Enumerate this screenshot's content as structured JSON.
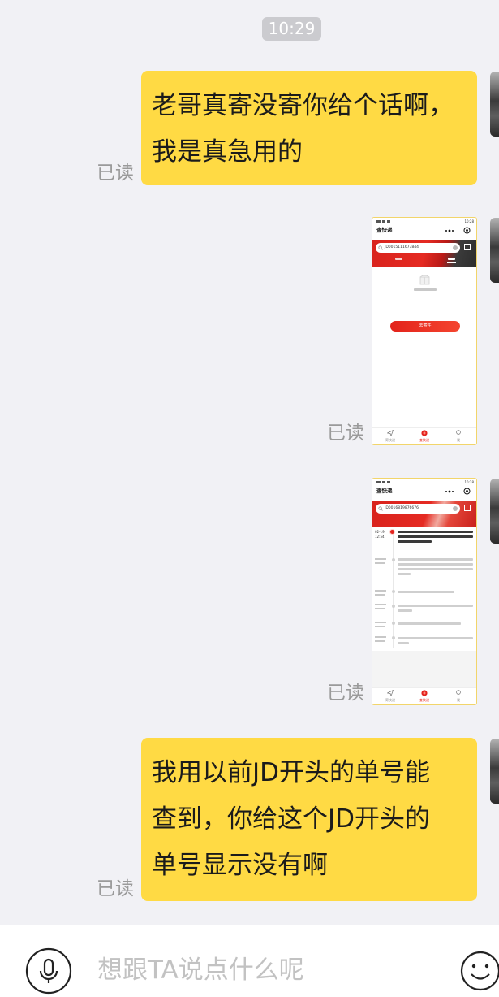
{
  "chat": {
    "time_divider": "10:29",
    "messages": [
      {
        "lines": [
          "老哥真寄没寄你给个话啊，",
          "我是真急用的"
        ],
        "read_status": "已读"
      },
      {
        "read_status": "已读",
        "screenshot": {
          "status_time": "10:28",
          "title": "查快递",
          "tracking_number": "JD0015111677844",
          "button_label": "去寄件",
          "nav": [
            "寄快递",
            "查快递",
            "我"
          ]
        }
      },
      {
        "read_status": "已读",
        "screenshot": {
          "status_time": "10:28",
          "title": "查快递",
          "tracking_number": "JD0016819876676",
          "first_event": {
            "date": "02-19",
            "time": "12:54"
          },
          "nav": [
            "寄快递",
            "查快递",
            "我"
          ]
        }
      },
      {
        "lines": [
          "我用以前JD开头的单号能",
          "查到，你给这个JD开头的",
          "单号显示没有啊"
        ],
        "read_status": "已读"
      }
    ]
  },
  "composer": {
    "placeholder": "想跟TA说点什么呢"
  },
  "icons": {
    "voice_button": "microphone-icon",
    "emoji_button": "smiley-icon",
    "empty_state": "package-icon",
    "nav_send": "paper-plane-icon",
    "nav_track": "courier-icon",
    "nav_me": "person-icon"
  },
  "colors": {
    "background": "#f1f1f5",
    "bubble": "#ffda44",
    "accent_red": "#e3231e",
    "read_status": "#9a9a9a"
  }
}
